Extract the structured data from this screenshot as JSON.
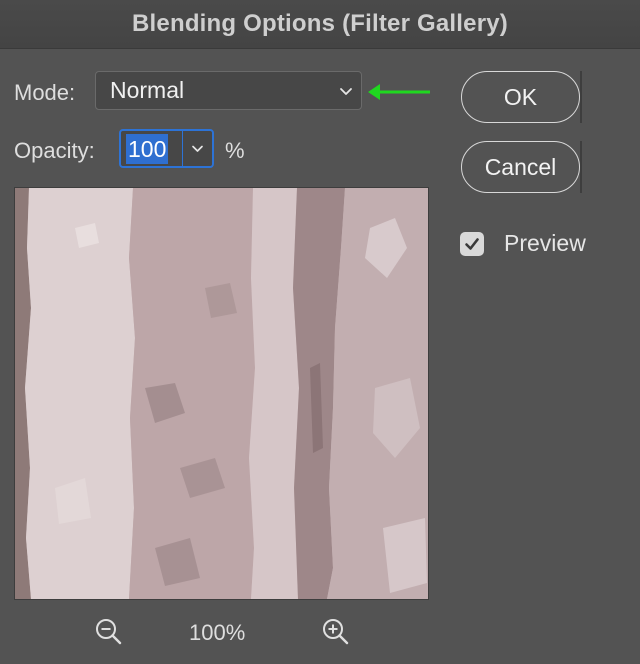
{
  "window": {
    "title": "Blending Options (Filter Gallery)"
  },
  "mode": {
    "label": "Mode:",
    "value": "Normal"
  },
  "opacity": {
    "label": "Opacity:",
    "value": "100",
    "unit": "%"
  },
  "buttons": {
    "ok": "OK",
    "cancel": "Cancel"
  },
  "preview": {
    "label": "Preview",
    "checked": true
  },
  "zoom": {
    "level": "100%"
  },
  "annotation": {
    "arrow_color": "#1fd81f"
  },
  "colors": {
    "dialog_bg": "#535353",
    "selection": "#2f6fd0"
  }
}
